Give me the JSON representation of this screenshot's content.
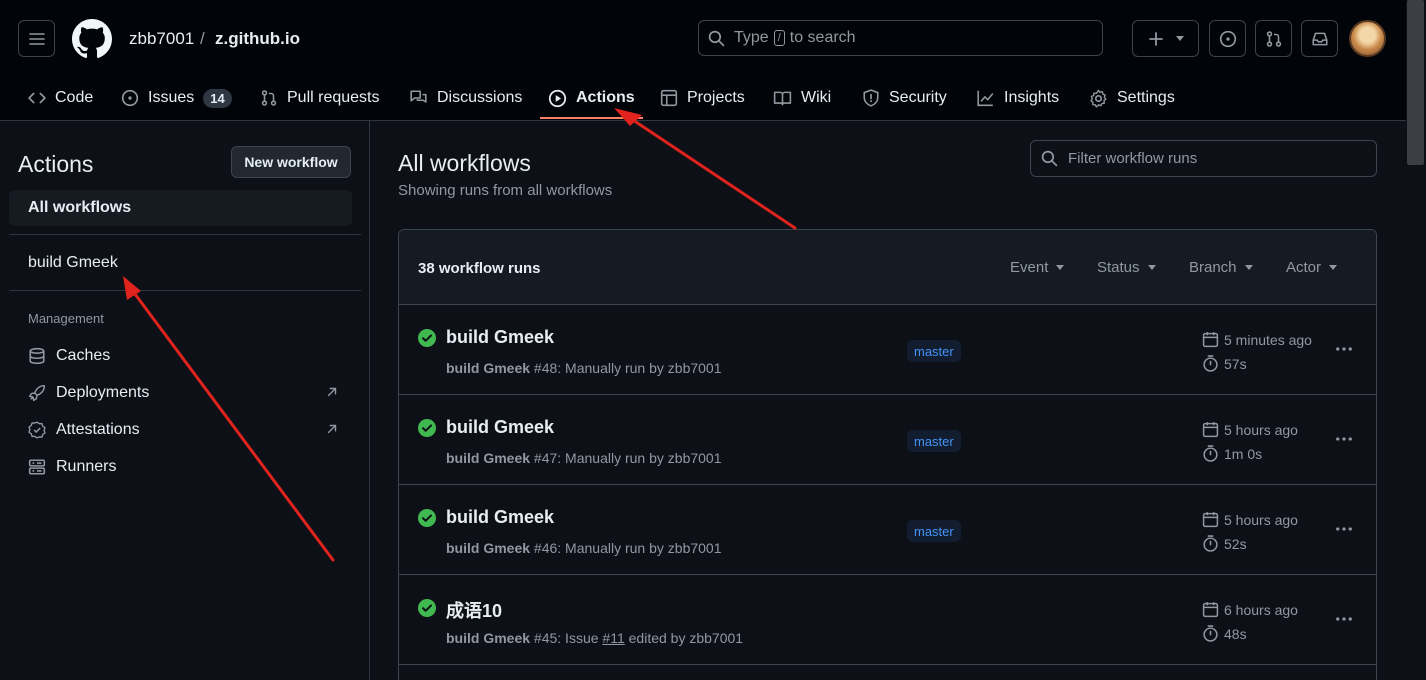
{
  "header": {
    "owner": "zbb7001",
    "separator": "/",
    "repo": "z.github.io",
    "search_prefix": "Type",
    "search_key": "/",
    "search_suffix": "to search"
  },
  "tabs": [
    {
      "label": "Code"
    },
    {
      "label": "Issues",
      "count": "14"
    },
    {
      "label": "Pull requests"
    },
    {
      "label": "Discussions"
    },
    {
      "label": "Actions"
    },
    {
      "label": "Projects"
    },
    {
      "label": "Wiki"
    },
    {
      "label": "Security"
    },
    {
      "label": "Insights"
    },
    {
      "label": "Settings"
    }
  ],
  "sidebar": {
    "title": "Actions",
    "new_workflow": "New workflow",
    "all_workflows": "All workflows",
    "workflow": "build Gmeek",
    "management_label": "Management",
    "management": [
      {
        "label": "Caches"
      },
      {
        "label": "Deployments"
      },
      {
        "label": "Attestations"
      },
      {
        "label": "Runners"
      }
    ]
  },
  "main": {
    "title": "All workflows",
    "subtitle": "Showing runs from all workflows",
    "filter_placeholder": "Filter workflow runs",
    "run_count": "38 workflow runs",
    "filters": [
      "Event",
      "Status",
      "Branch",
      "Actor"
    ]
  },
  "runs": [
    {
      "title": "build Gmeek",
      "workflow": "build Gmeek",
      "detail": "#48: Manually run by zbb7001",
      "branch": "master",
      "time": "5 minutes ago",
      "duration": "57s"
    },
    {
      "title": "build Gmeek",
      "workflow": "build Gmeek",
      "detail": "#47: Manually run by zbb7001",
      "branch": "master",
      "time": "5 hours ago",
      "duration": "1m 0s"
    },
    {
      "title": "build Gmeek",
      "workflow": "build Gmeek",
      "detail": "#46: Manually run by zbb7001",
      "branch": "master",
      "time": "5 hours ago",
      "duration": "52s"
    },
    {
      "title": "成语10",
      "workflow": "build Gmeek",
      "detail_pre": "#45: Issue",
      "issue": "#11",
      "detail_post": "edited by zbb7001",
      "branch": "",
      "time": "6 hours ago",
      "duration": "48s"
    }
  ],
  "colors": {
    "background": "#0d1117",
    "header": "#010409",
    "accent_blue": "#1f6feb",
    "success_green": "#3fb950",
    "annotation_red": "#e0231c"
  }
}
